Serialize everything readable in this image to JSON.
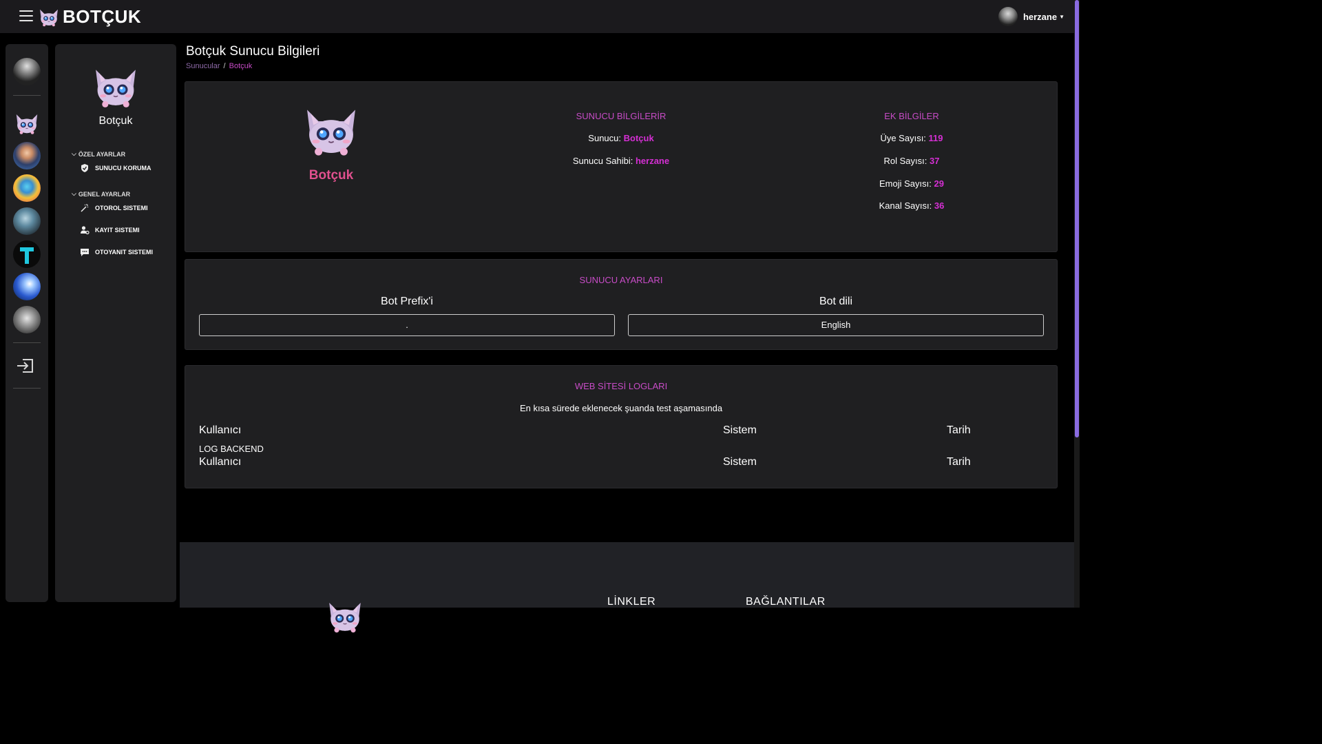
{
  "header": {
    "brand": "BOTÇUK",
    "user_name": "herzane"
  },
  "sidebar": {
    "server_name": "Botçuk",
    "sections": [
      {
        "label": "ÖZEL AYARLAR",
        "items": [
          {
            "label": "SUNUCU KORUMA",
            "icon": "shield-icon"
          }
        ]
      },
      {
        "label": "GENEL AYARLAR",
        "items": [
          {
            "label": "OTOROL SISTEMI",
            "icon": "magic-wand-icon"
          },
          {
            "label": "KAYIT SISTEMI",
            "icon": "user-gear-icon"
          },
          {
            "label": "OTOYANIT SISTEMI",
            "icon": "chat-icon"
          }
        ]
      }
    ]
  },
  "page": {
    "title": "Botçuk Sunucu Bilgileri",
    "breadcrumb": [
      "Sunucular",
      "Botçuk"
    ]
  },
  "server_info": {
    "name": "Botçuk",
    "heading": "SUNUCU BİLGİLERİR",
    "server_label": "Sunucu:",
    "server_value": "Botçuk",
    "owner_label": "Sunucu Sahibi:",
    "owner_value": "herzane"
  },
  "extra_info": {
    "heading": "EK BİLGİLER",
    "members_label": "Üye Sayısı:",
    "members_value": "119",
    "roles_label": "Rol Sayısı:",
    "roles_value": "37",
    "emojis_label": "Emoji Sayısı:",
    "emojis_value": "29",
    "channels_label": "Kanal Sayısı:",
    "channels_value": "36"
  },
  "settings": {
    "heading": "SUNUCU AYARLARI",
    "prefix_label": "Bot Prefix'i",
    "prefix_value": ".",
    "language_label": "Bot dili",
    "language_value": "English"
  },
  "logs": {
    "heading": "WEB SİTESİ LOGLARI",
    "note": "En kısa sürede eklenecek şuanda test aşamasında",
    "columns": [
      "Kullanıcı",
      "Sistem",
      "Tarih"
    ],
    "backend_label": "LOG BACKEND",
    "row": [
      "Kullanıcı",
      "Sistem",
      "Tarih"
    ]
  },
  "footer": {
    "links_heading": "LİNKLER",
    "connections_heading": "BAĞLANTILAR"
  },
  "colors": {
    "accent": "#d52fd4",
    "heading": "#c84cc7",
    "brand_name": "#e0508e",
    "scrollbar": "#8a6be0"
  }
}
